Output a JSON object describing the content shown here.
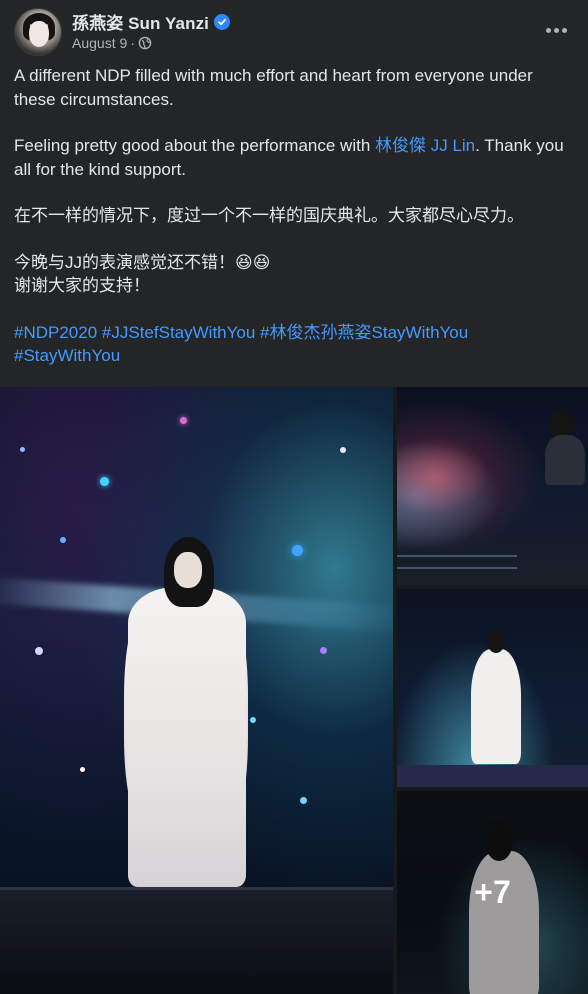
{
  "author": {
    "name": "孫燕姿 Sun Yanzi",
    "date": "August 9",
    "separator": "·"
  },
  "post": {
    "line1": "A different NDP filled with much effort and heart from everyone under these circumstances.",
    "line2_prefix": "Feeling pretty good about the performance with ",
    "line2_mention": "林俊傑  JJ Lin",
    "line2_suffix": ". Thank you all for the kind support.",
    "line3": "在不一样的情况下，度过一个不一样的国庆典礼。大家都尽心尽力。",
    "line4a": "今晚与JJ的表演感觉还不错！😆😆",
    "line4b": "谢谢大家的支持！",
    "hashtags": [
      "#NDP2020",
      "#JJStefStayWithYou",
      "#林俊杰孙燕姿StayWithYou",
      "#StayWithYou"
    ]
  },
  "photos": {
    "more_count": "+7"
  },
  "icons": {
    "verified": "verified-badge-icon",
    "audience": "globe-icon",
    "more": "more-options-icon"
  },
  "colors": {
    "background": "#242526",
    "text": "#e4e6eb",
    "muted": "#b0b3b8",
    "link": "#4599ff",
    "verified": "#2d88ff"
  }
}
